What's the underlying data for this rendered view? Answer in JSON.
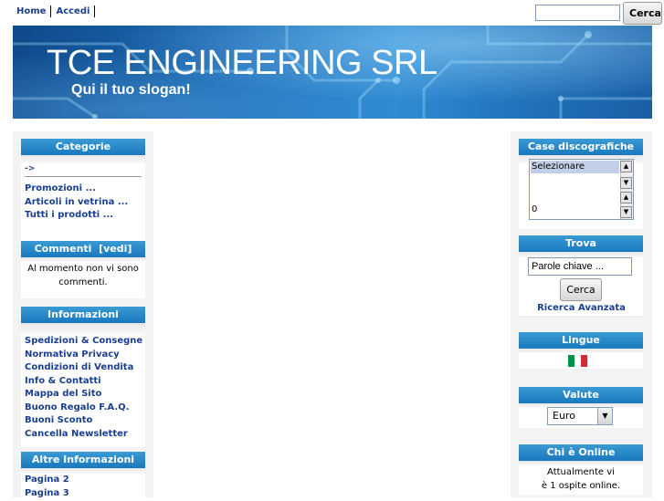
{
  "topnav": {
    "home": "Home",
    "login": "Accedi"
  },
  "search": {
    "value": "",
    "button": "Cerca"
  },
  "banner": {
    "title": "TCE ENGINEERING SRL",
    "slogan": "Qui il tuo slogan!"
  },
  "left": {
    "categorie": {
      "title": "Categorie",
      "arrow": "->",
      "items": [
        "Promozioni ...",
        "Articoli in vetrina ...",
        "Tutti i prodotti ..."
      ]
    },
    "commenti": {
      "title": "Commenti  [vedi]",
      "text": "Al momento non vi sono commenti."
    },
    "informazioni": {
      "title": "Informazioni",
      "items": [
        "Spedizioni & Consegne",
        "Normativa Privacy",
        "Condizioni di Vendita",
        "Info & Contatti",
        "Mappa del Sito",
        "Buono Regalo F.A.Q.",
        "Buoni Sconto",
        "Cancella Newsletter"
      ]
    },
    "altre": {
      "title": "Altre Informazioni",
      "items": [
        "Pagina 2",
        "Pagina 3"
      ]
    }
  },
  "right": {
    "case": {
      "title": "Case discografiche",
      "selected": "Selezionare",
      "count": "0"
    },
    "trova": {
      "title": "Trova",
      "placeholder": "Parole chiave ...",
      "button": "Cerca",
      "advanced": "Ricerca Avanzata"
    },
    "lingue": {
      "title": "Lingue",
      "flag_colors": [
        "#009246",
        "#ffffff",
        "#ce2b37"
      ]
    },
    "valute": {
      "title": "Valute",
      "selected": "Euro"
    },
    "online": {
      "title": "Chi è Online",
      "line1": "Attualmente vi",
      "line2": "è 1 ospite online."
    }
  },
  "colors": {
    "accent": "#1a78bd",
    "link": "#1a3f8f"
  }
}
